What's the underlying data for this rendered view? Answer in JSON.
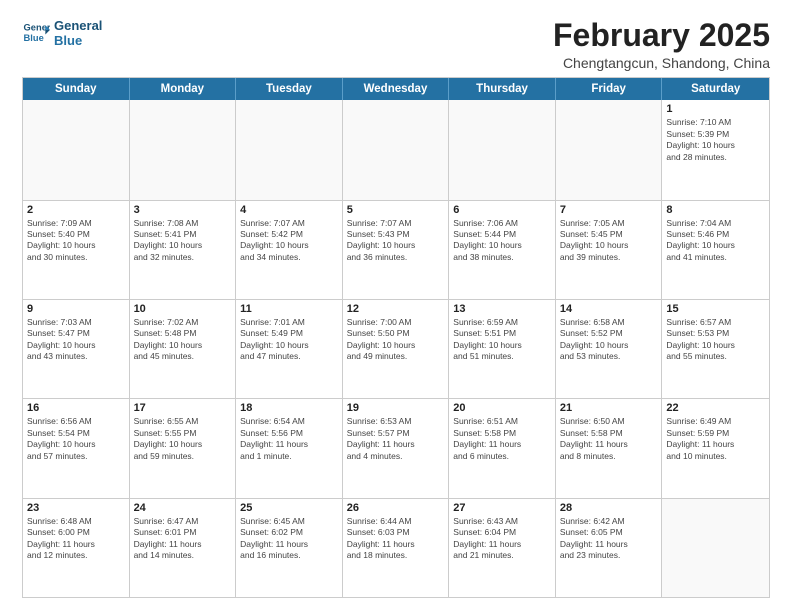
{
  "logo": {
    "line1": "General",
    "line2": "Blue"
  },
  "title": "February 2025",
  "subtitle": "Chengtangcun, Shandong, China",
  "days_of_week": [
    "Sunday",
    "Monday",
    "Tuesday",
    "Wednesday",
    "Thursday",
    "Friday",
    "Saturday"
  ],
  "weeks": [
    [
      {
        "day": "",
        "info": ""
      },
      {
        "day": "",
        "info": ""
      },
      {
        "day": "",
        "info": ""
      },
      {
        "day": "",
        "info": ""
      },
      {
        "day": "",
        "info": ""
      },
      {
        "day": "",
        "info": ""
      },
      {
        "day": "1",
        "info": "Sunrise: 7:10 AM\nSunset: 5:39 PM\nDaylight: 10 hours\nand 28 minutes."
      }
    ],
    [
      {
        "day": "2",
        "info": "Sunrise: 7:09 AM\nSunset: 5:40 PM\nDaylight: 10 hours\nand 30 minutes."
      },
      {
        "day": "3",
        "info": "Sunrise: 7:08 AM\nSunset: 5:41 PM\nDaylight: 10 hours\nand 32 minutes."
      },
      {
        "day": "4",
        "info": "Sunrise: 7:07 AM\nSunset: 5:42 PM\nDaylight: 10 hours\nand 34 minutes."
      },
      {
        "day": "5",
        "info": "Sunrise: 7:07 AM\nSunset: 5:43 PM\nDaylight: 10 hours\nand 36 minutes."
      },
      {
        "day": "6",
        "info": "Sunrise: 7:06 AM\nSunset: 5:44 PM\nDaylight: 10 hours\nand 38 minutes."
      },
      {
        "day": "7",
        "info": "Sunrise: 7:05 AM\nSunset: 5:45 PM\nDaylight: 10 hours\nand 39 minutes."
      },
      {
        "day": "8",
        "info": "Sunrise: 7:04 AM\nSunset: 5:46 PM\nDaylight: 10 hours\nand 41 minutes."
      }
    ],
    [
      {
        "day": "9",
        "info": "Sunrise: 7:03 AM\nSunset: 5:47 PM\nDaylight: 10 hours\nand 43 minutes."
      },
      {
        "day": "10",
        "info": "Sunrise: 7:02 AM\nSunset: 5:48 PM\nDaylight: 10 hours\nand 45 minutes."
      },
      {
        "day": "11",
        "info": "Sunrise: 7:01 AM\nSunset: 5:49 PM\nDaylight: 10 hours\nand 47 minutes."
      },
      {
        "day": "12",
        "info": "Sunrise: 7:00 AM\nSunset: 5:50 PM\nDaylight: 10 hours\nand 49 minutes."
      },
      {
        "day": "13",
        "info": "Sunrise: 6:59 AM\nSunset: 5:51 PM\nDaylight: 10 hours\nand 51 minutes."
      },
      {
        "day": "14",
        "info": "Sunrise: 6:58 AM\nSunset: 5:52 PM\nDaylight: 10 hours\nand 53 minutes."
      },
      {
        "day": "15",
        "info": "Sunrise: 6:57 AM\nSunset: 5:53 PM\nDaylight: 10 hours\nand 55 minutes."
      }
    ],
    [
      {
        "day": "16",
        "info": "Sunrise: 6:56 AM\nSunset: 5:54 PM\nDaylight: 10 hours\nand 57 minutes."
      },
      {
        "day": "17",
        "info": "Sunrise: 6:55 AM\nSunset: 5:55 PM\nDaylight: 10 hours\nand 59 minutes."
      },
      {
        "day": "18",
        "info": "Sunrise: 6:54 AM\nSunset: 5:56 PM\nDaylight: 11 hours\nand 1 minute."
      },
      {
        "day": "19",
        "info": "Sunrise: 6:53 AM\nSunset: 5:57 PM\nDaylight: 11 hours\nand 4 minutes."
      },
      {
        "day": "20",
        "info": "Sunrise: 6:51 AM\nSunset: 5:58 PM\nDaylight: 11 hours\nand 6 minutes."
      },
      {
        "day": "21",
        "info": "Sunrise: 6:50 AM\nSunset: 5:58 PM\nDaylight: 11 hours\nand 8 minutes."
      },
      {
        "day": "22",
        "info": "Sunrise: 6:49 AM\nSunset: 5:59 PM\nDaylight: 11 hours\nand 10 minutes."
      }
    ],
    [
      {
        "day": "23",
        "info": "Sunrise: 6:48 AM\nSunset: 6:00 PM\nDaylight: 11 hours\nand 12 minutes."
      },
      {
        "day": "24",
        "info": "Sunrise: 6:47 AM\nSunset: 6:01 PM\nDaylight: 11 hours\nand 14 minutes."
      },
      {
        "day": "25",
        "info": "Sunrise: 6:45 AM\nSunset: 6:02 PM\nDaylight: 11 hours\nand 16 minutes."
      },
      {
        "day": "26",
        "info": "Sunrise: 6:44 AM\nSunset: 6:03 PM\nDaylight: 11 hours\nand 18 minutes."
      },
      {
        "day": "27",
        "info": "Sunrise: 6:43 AM\nSunset: 6:04 PM\nDaylight: 11 hours\nand 21 minutes."
      },
      {
        "day": "28",
        "info": "Sunrise: 6:42 AM\nSunset: 6:05 PM\nDaylight: 11 hours\nand 23 minutes."
      },
      {
        "day": "",
        "info": ""
      }
    ]
  ]
}
